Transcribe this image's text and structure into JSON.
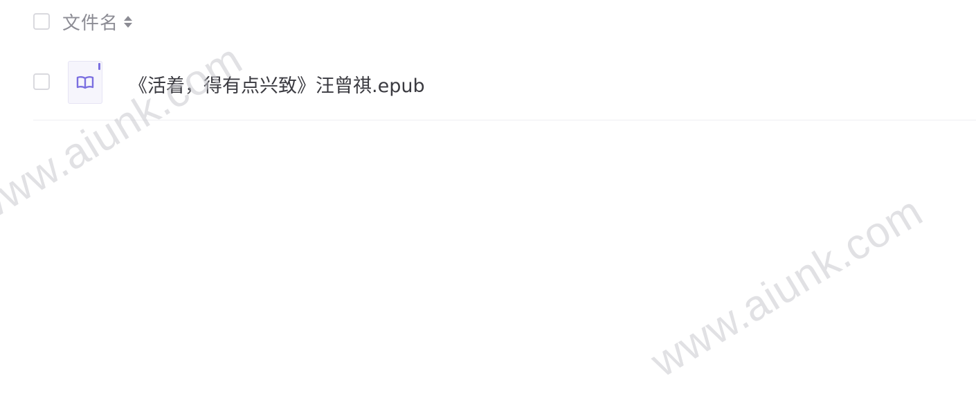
{
  "header": {
    "column_label": "文件名",
    "sort_icon": "sort-icon"
  },
  "files": [
    {
      "name": "《活着，得有点兴致》汪曾祺.epub",
      "icon": "book-icon",
      "icon_color": "#7b6fe0"
    }
  ],
  "watermark": {
    "text": "www.aiunk.com"
  }
}
